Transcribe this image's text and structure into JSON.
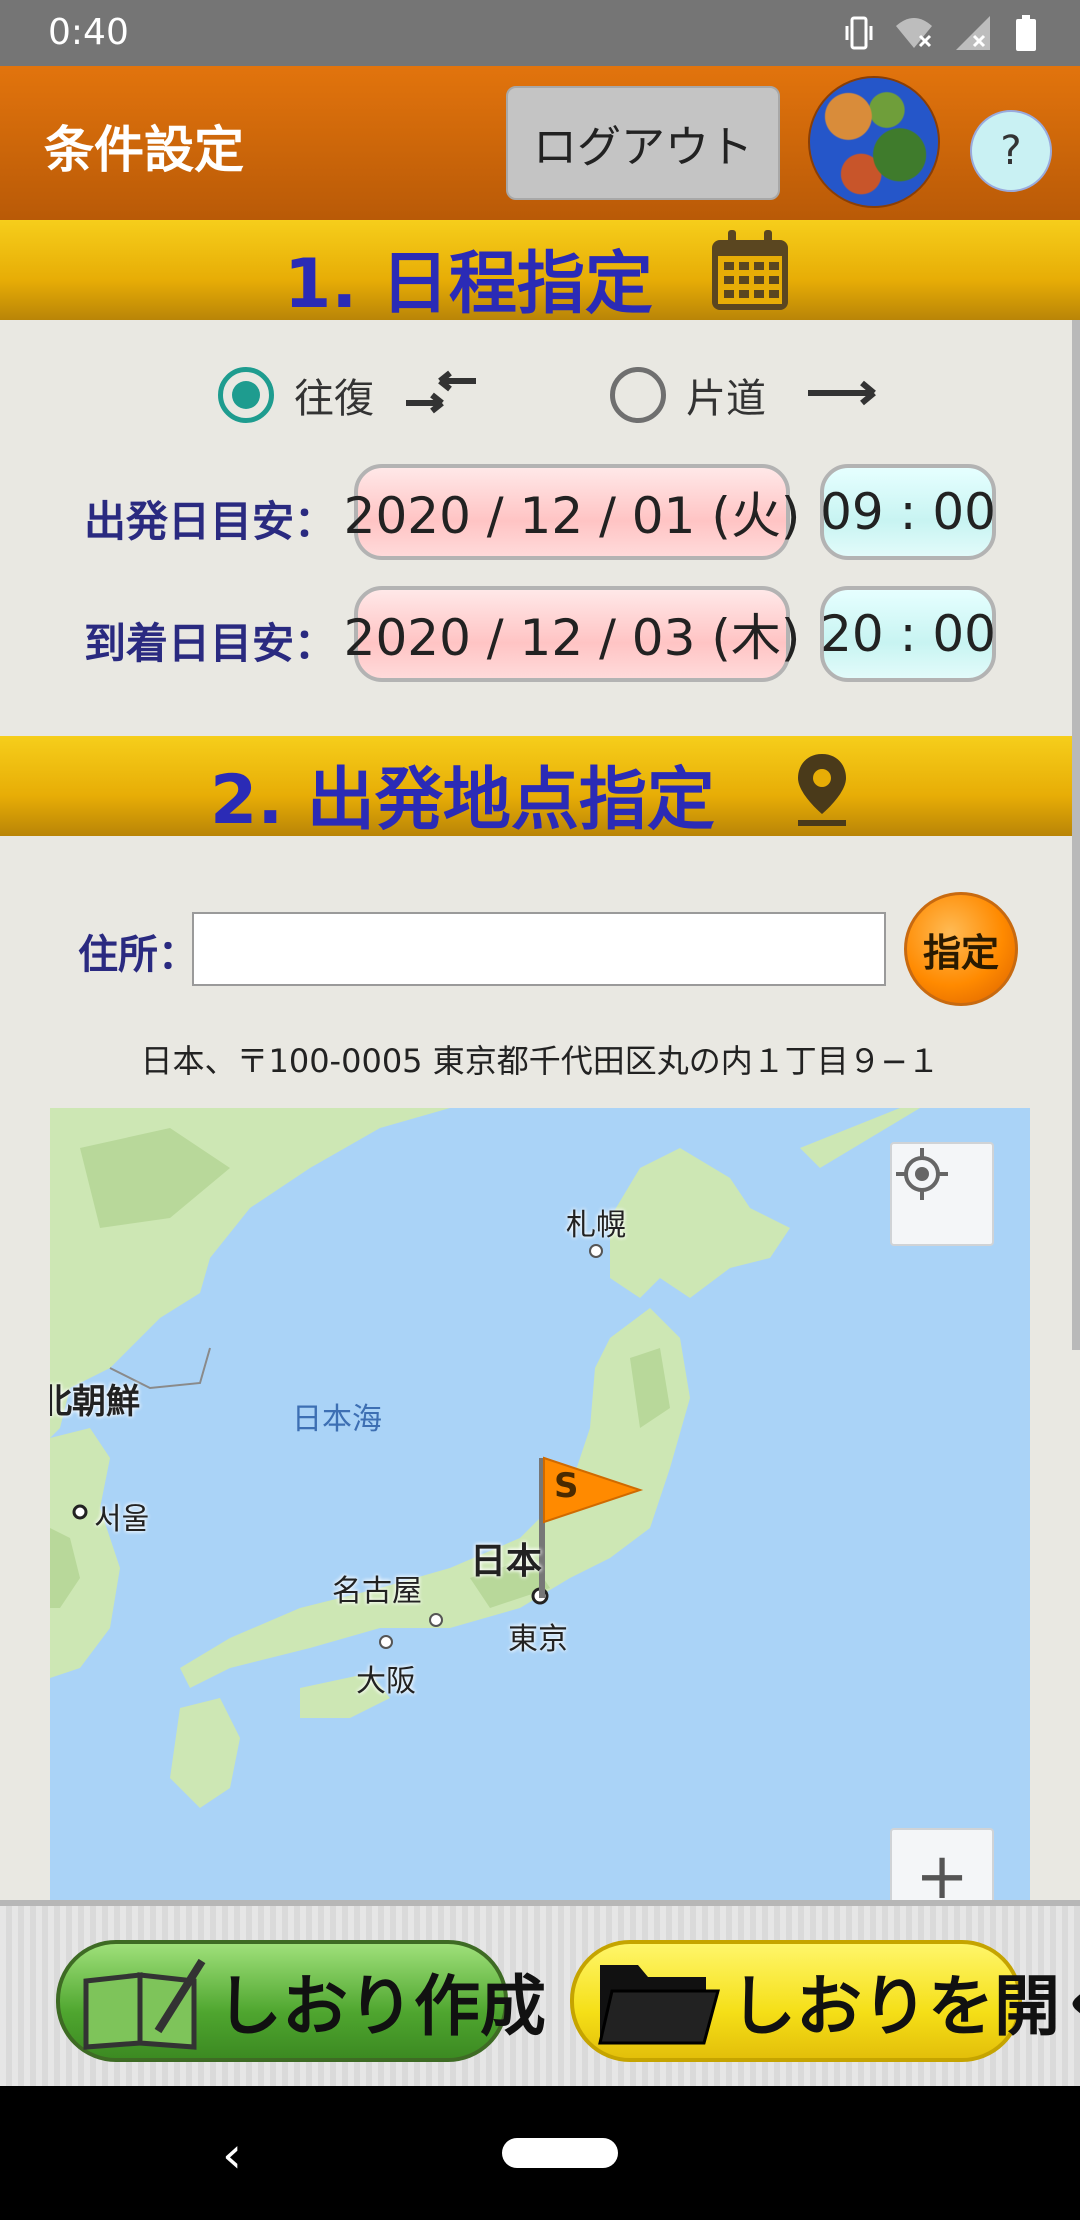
{
  "status_bar": {
    "time": "0:40",
    "icons": [
      "vibrate-icon",
      "wifi-off-icon",
      "signal-off-icon",
      "battery-icon"
    ]
  },
  "header": {
    "title": "条件設定",
    "logout_label": "ログアウト",
    "help_label": "?"
  },
  "section1": {
    "title": "1. 日程指定",
    "trip_options": [
      {
        "label": "往復",
        "selected": true,
        "icon": "swap-arrows-icon"
      },
      {
        "label": "片道",
        "selected": false,
        "icon": "right-arrow-icon"
      }
    ],
    "departure": {
      "label": "出発日目安：",
      "date": "2020 / 12 / 01 (火)",
      "time": "09 : 00"
    },
    "arrival": {
      "label": "到着日目安：",
      "date": "2020 / 12 / 03 (木)",
      "time": "20 : 00"
    }
  },
  "section2": {
    "title": "2. 出発地点指定",
    "address_label": "住所：",
    "address_value": "",
    "set_button_label": "指定",
    "resolved_address": "日本、〒100-0005 東京都千代田区丸の内１丁目９−１",
    "map": {
      "labels": {
        "sapporo": "札幌",
        "japan_sea": "日本海",
        "north_korea": "北朝鮮",
        "seoul": "서울",
        "japan": "日本",
        "nagoya": "名古屋",
        "tokyo": "東京",
        "osaka": "大阪"
      },
      "flag_letter": "S",
      "zoom_in_label": "+"
    }
  },
  "bottom": {
    "create_label": "しおり作成",
    "open_label": "しおりを開く"
  },
  "colors": {
    "header_orange": "#d46a0a",
    "section_yellow": "#f2c010",
    "section_title": "#2b2bb6",
    "radio_selected": "#1e9c8f",
    "map_water": "#aad3f7",
    "map_land": "#cde7b4"
  }
}
